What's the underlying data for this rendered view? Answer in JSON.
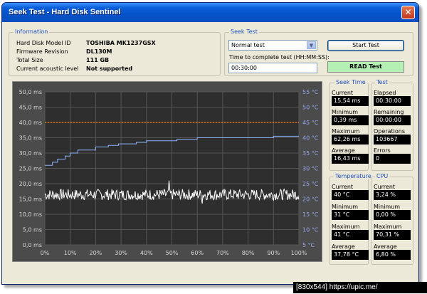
{
  "window": {
    "title": "Seek Test - Hard Disk Sentinel",
    "close_glyph": "✕"
  },
  "information": {
    "label": "Information",
    "rows": [
      {
        "key": "Hard Disk Model ID",
        "value": "TOSHIBA MK1237GSX"
      },
      {
        "key": "Firmware Revision",
        "value": "DL130M"
      },
      {
        "key": "Total Size",
        "value": "111 GB"
      },
      {
        "key": "Current acoustic level",
        "value": "Not supported"
      }
    ]
  },
  "seek_test": {
    "label": "Seek Test",
    "mode": "Normal test",
    "time_label": "Time to complete test (HH:MM:SS):",
    "time_value": "00:30:00",
    "start_button": "Start Test",
    "status": "READ Test"
  },
  "seek_time": {
    "label": "Seek Time",
    "items": [
      {
        "label": "Current",
        "value": "15,54 ms"
      },
      {
        "label": "Minimum",
        "value": "0,39 ms"
      },
      {
        "label": "Maximum",
        "value": "62,26 ms"
      },
      {
        "label": "Average",
        "value": "16,43 ms"
      }
    ]
  },
  "test": {
    "label": "Test",
    "items": [
      {
        "label": "Elapsed",
        "value": "00:30:00"
      },
      {
        "label": "Remaining",
        "value": "00:00:00"
      },
      {
        "label": "Operations",
        "value": "103667"
      },
      {
        "label": "Errors",
        "value": "0"
      }
    ]
  },
  "temperature": {
    "label": "Temperature",
    "items": [
      {
        "label": "Current",
        "value": "40 °C"
      },
      {
        "label": "Minimum",
        "value": "31 °C"
      },
      {
        "label": "Maximum",
        "value": "41 °C"
      },
      {
        "label": "Average",
        "value": "37,78 °C"
      }
    ]
  },
  "cpu": {
    "label": "CPU",
    "items": [
      {
        "label": "Current",
        "value": "3,24 %"
      },
      {
        "label": "Minimum",
        "value": "0,00 %"
      },
      {
        "label": "Maximum",
        "value": "70,31 %"
      },
      {
        "label": "Average",
        "value": "6,80 %"
      }
    ]
  },
  "footer": {
    "text": "[830x544] https://upic.me/"
  },
  "chart_data": {
    "type": "line",
    "x_ticks": [
      "0%",
      "10%",
      "20%",
      "30%",
      "40%",
      "50%",
      "60%",
      "70%",
      "80%",
      "90%",
      "100%"
    ],
    "y_ticks_left": [
      "0,0 ms",
      "5,0 ms",
      "10,0 ms",
      "15,0 ms",
      "20,0 ms",
      "25,0 ms",
      "30,0 ms",
      "35,0 ms",
      "40,0 ms",
      "45,0 ms",
      "50,0 ms"
    ],
    "y_ticks_right": [
      "5 °C",
      "10 °C",
      "15 °C",
      "20 °C",
      "25 °C",
      "30 °C",
      "35 °C",
      "40 °C",
      "45 °C",
      "50 °C",
      "55 °C"
    ],
    "ylim_left": [
      0,
      50
    ],
    "ylim_right": [
      5,
      55
    ],
    "reference_lines": [
      {
        "value": 45,
        "axis": "right",
        "color": "#d02020"
      },
      {
        "value": 40,
        "axis": "left",
        "color": "#e0c020"
      }
    ],
    "series": [
      {
        "axis": "right",
        "color": "#8fb4ff",
        "x": [
          0,
          3,
          3,
          5,
          5,
          8,
          8,
          10,
          10,
          13,
          13,
          20,
          20,
          25,
          25,
          29,
          29,
          36,
          36,
          40,
          40,
          47,
          47,
          52,
          52,
          60,
          60,
          70,
          70,
          80,
          80,
          90,
          90,
          100
        ],
        "y": [
          31,
          31,
          32,
          32,
          33,
          33,
          34,
          34,
          35,
          35,
          36,
          36,
          37,
          37,
          37.5,
          37.5,
          38,
          38,
          38.5,
          38.5,
          39,
          39,
          39,
          39,
          39.5,
          39.5,
          40,
          40,
          40,
          40,
          40,
          40,
          40.5,
          40.5
        ]
      },
      {
        "axis": "left",
        "color": "#ffffff",
        "average": 16.43,
        "spread": 1.8,
        "spikes": [
          {
            "x": 49,
            "y": 21
          },
          {
            "x": 62,
            "y": 13.5
          }
        ]
      }
    ]
  }
}
